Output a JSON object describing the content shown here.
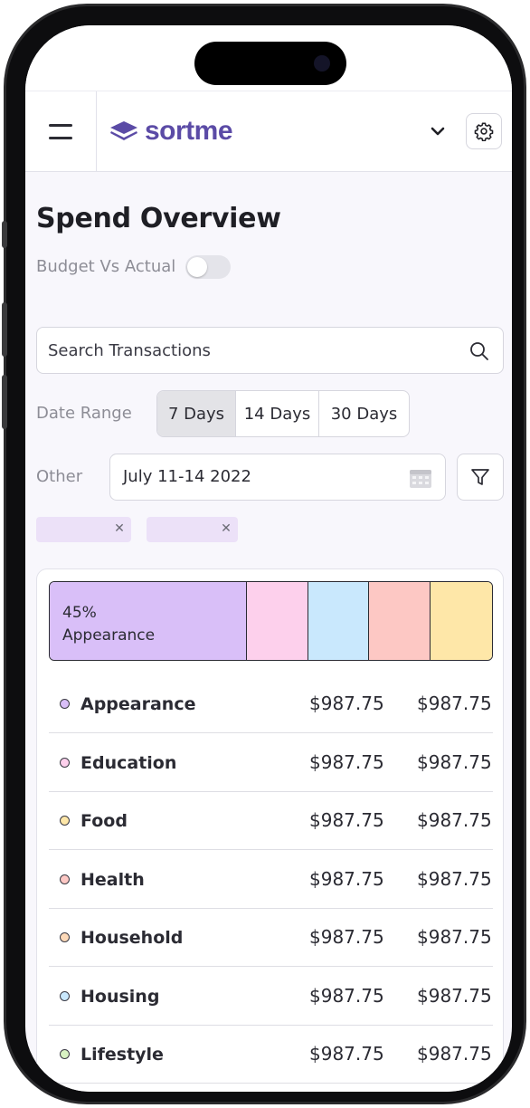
{
  "app": {
    "brand": "sortme"
  },
  "page": {
    "title": "Spend Overview"
  },
  "budget_toggle": {
    "label": "Budget Vs Actual",
    "on": false
  },
  "search": {
    "placeholder": "Search Transactions"
  },
  "date_range": {
    "label": "Date Range",
    "options": [
      {
        "label": "7 Days",
        "active": true
      },
      {
        "label": "14 Days",
        "active": false
      },
      {
        "label": "30 Days",
        "active": false
      }
    ]
  },
  "other": {
    "label": "Other",
    "date_value": "July 11-14 2022"
  },
  "chips": [
    {
      "label": ""
    },
    {
      "label": ""
    }
  ],
  "spend_bar": {
    "top_label_percent": "45%",
    "top_label_category": "Appearance",
    "segments": [
      {
        "name": "Appearance",
        "share": 45,
        "color": "#d9bff8"
      },
      {
        "name": "Education",
        "share": 14,
        "color": "#fdd0ec"
      },
      {
        "name": "Housing",
        "share": 14,
        "color": "#c9e8fd"
      },
      {
        "name": "Health",
        "share": 14,
        "color": "#fdc8c4"
      },
      {
        "name": "Food",
        "share": 14,
        "color": "#fee7a8"
      }
    ]
  },
  "categories": [
    {
      "name": "Appearance",
      "budget": "$987.75",
      "actual": "$987.75",
      "color": "#d9bff8"
    },
    {
      "name": "Education",
      "budget": "$987.75",
      "actual": "$987.75",
      "color": "#fdd0ec"
    },
    {
      "name": "Food",
      "budget": "$987.75",
      "actual": "$987.75",
      "color": "#fee7a8"
    },
    {
      "name": "Health",
      "budget": "$987.75",
      "actual": "$987.75",
      "color": "#fdc8c4"
    },
    {
      "name": "Household",
      "budget": "$987.75",
      "actual": "$987.75",
      "color": "#fdd9b8"
    },
    {
      "name": "Housing",
      "budget": "$987.75",
      "actual": "$987.75",
      "color": "#c9e8fd"
    },
    {
      "name": "Lifestyle",
      "budget": "$987.75",
      "actual": "$987.75",
      "color": "#d8f2c2"
    }
  ],
  "icons": {
    "menu": "hamburger-icon",
    "logo": "stacked-layers-icon",
    "dropdown": "chevron-down-icon",
    "settings": "gear-icon",
    "search": "search-icon",
    "calendar": "calendar-icon",
    "filter": "filter-icon",
    "chip_close": "close-icon"
  }
}
